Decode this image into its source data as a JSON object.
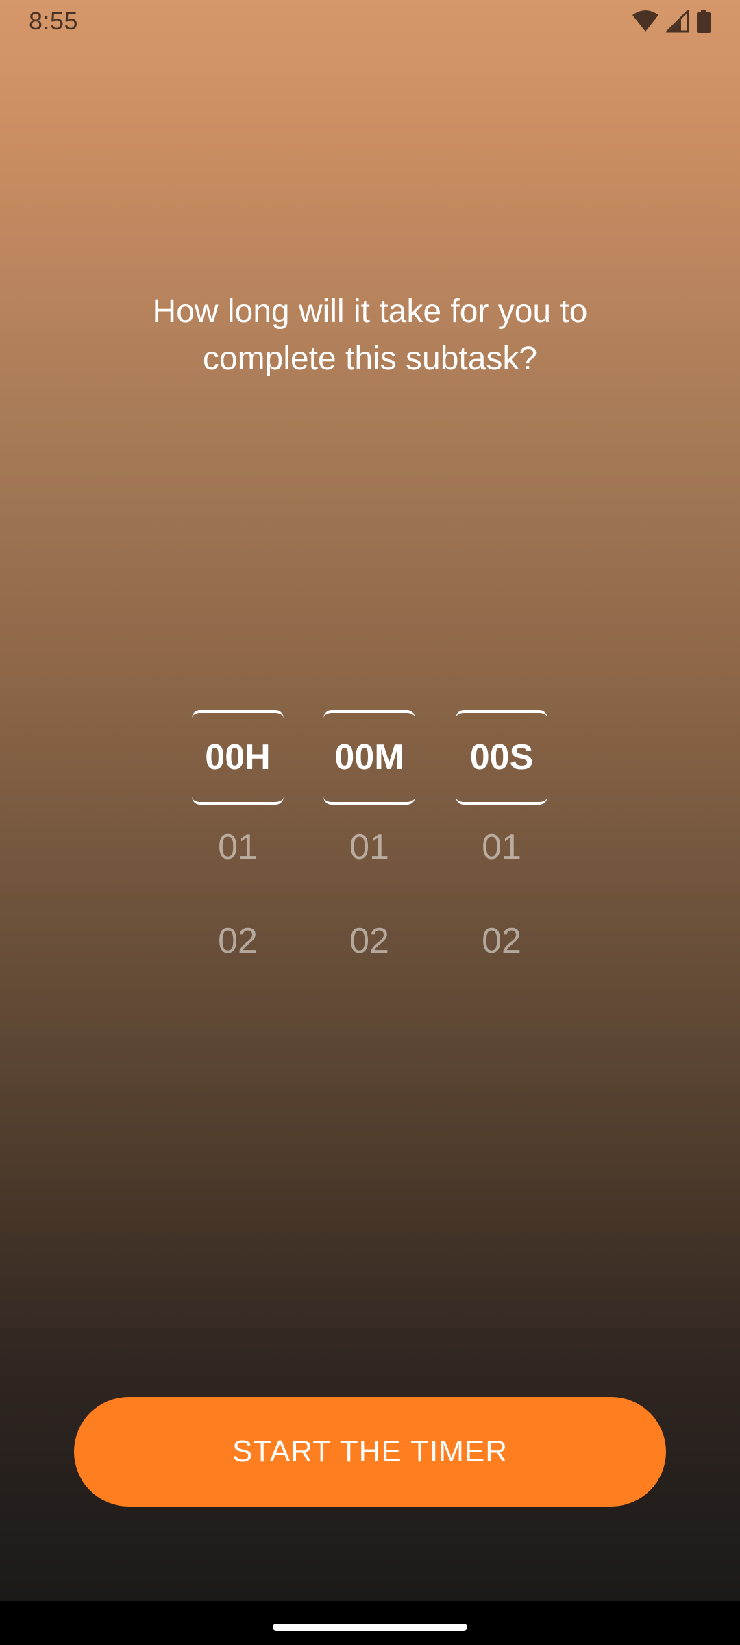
{
  "status_bar": {
    "time": "8:55",
    "icons": [
      "wifi-icon",
      "cellular-signal-icon",
      "battery-icon"
    ]
  },
  "prompt": {
    "question": "How long will it take for you to complete this subtask?"
  },
  "picker": {
    "hours": {
      "selected": "00H",
      "options": [
        "01",
        "02"
      ]
    },
    "minutes": {
      "selected": "00M",
      "options": [
        "01",
        "02"
      ]
    },
    "seconds": {
      "selected": "00S",
      "options": [
        "01",
        "02"
      ]
    }
  },
  "actions": {
    "start_label": "START THE TIMER"
  },
  "colors": {
    "accent": "#ff7f20",
    "gradient_top": "#d6976a",
    "gradient_bottom": "#1a1a1a"
  }
}
